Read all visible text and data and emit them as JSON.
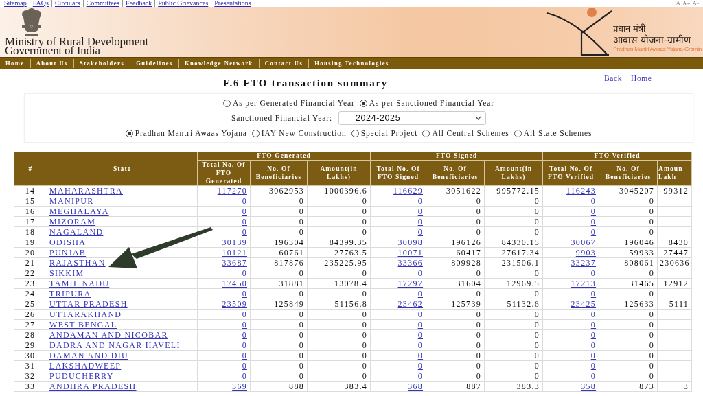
{
  "top_links": [
    "Sitemap",
    "FAQs",
    "Circulars",
    "Committees",
    "Feedback",
    "Public Grievances",
    "Presentations"
  ],
  "font_size_controls": [
    "A",
    "A+",
    "A-"
  ],
  "header": {
    "ministry": [
      "Ministry of Rural Development",
      "Government of India"
    ],
    "logo": {
      "hindi_line_1": "प्रधान मंत्री",
      "hindi_line_2": "आवास योजना-ग्रामीण",
      "english": "Pradhan Mantri Awaas Yojana-Gramin"
    }
  },
  "nav": [
    "Home",
    "About Us",
    "Stakeholders",
    "Guidelines",
    "Knowledge Network",
    "Contact Us",
    "Housing Technologies"
  ],
  "page": {
    "title": "F.6 FTO transaction summary",
    "links": [
      "Back",
      "Home"
    ]
  },
  "filters": {
    "year_basis": [
      {
        "label": "As per Generated Financial Year",
        "selected": false
      },
      {
        "label": "As per Sanctioned Financial Year",
        "selected": true
      }
    ],
    "year_field": {
      "label": "Sanctioned Financial Year:",
      "value": "2024-2025"
    },
    "schemes": [
      {
        "label": "Pradhan Mantri Awaas Yojana",
        "selected": true
      },
      {
        "label": "IAY New Construction",
        "selected": false
      },
      {
        "label": "Special Project",
        "selected": false
      },
      {
        "label": "All Central Schemes",
        "selected": false
      },
      {
        "label": "All State Schemes",
        "selected": false
      }
    ]
  },
  "table": {
    "groups": [
      "FTO Generated",
      "FTO Signed",
      "FTO Verified"
    ],
    "columns": [
      "#",
      "State",
      "Total No. Of FTO Generated",
      "No. Of Beneficiaries",
      "Amount(in Lakhs)",
      "Total No. Of FTO Signed",
      "No. Of Beneficiaries",
      "Amount(in Lakhs)",
      "Total No. Of FTO Verified",
      "No. Of Beneficiaries",
      "Amoun Lakh"
    ],
    "rows": [
      [
        "14",
        "MAHARASHTRA",
        "117270",
        "3062953",
        "1000396.6",
        "116629",
        "3051622",
        "995772.15",
        "116243",
        "3045207",
        "99312"
      ],
      [
        "15",
        "MANIPUR",
        "0",
        "0",
        "0",
        "0",
        "0",
        "0",
        "0",
        "0"
      ],
      [
        "16",
        "MEGHALAYA",
        "0",
        "0",
        "0",
        "0",
        "0",
        "0",
        "0",
        "0"
      ],
      [
        "17",
        "MIZORAM",
        "0",
        "0",
        "0",
        "0",
        "0",
        "0",
        "0",
        "0"
      ],
      [
        "18",
        "NAGALAND",
        "0",
        "0",
        "0",
        "0",
        "0",
        "0",
        "0",
        "0"
      ],
      [
        "19",
        "ODISHA",
        "30139",
        "196304",
        "84399.35",
        "30098",
        "196126",
        "84330.15",
        "30067",
        "196046",
        "8430"
      ],
      [
        "20",
        "PUNJAB",
        "10121",
        "60761",
        "27763.5",
        "10071",
        "60417",
        "27617.34",
        "9903",
        "59933",
        "27447"
      ],
      [
        "21",
        "RAJASTHAN",
        "33687",
        "817876",
        "235225.95",
        "33366",
        "809928",
        "231506.1",
        "33237",
        "808061",
        "230636"
      ],
      [
        "22",
        "SIKKIM",
        "0",
        "0",
        "0",
        "0",
        "0",
        "0",
        "0",
        "0"
      ],
      [
        "23",
        "TAMIL NADU",
        "17450",
        "31881",
        "13078.4",
        "17297",
        "31604",
        "12969.5",
        "17213",
        "31465",
        "12912"
      ],
      [
        "24",
        "TRIPURA",
        "0",
        "0",
        "0",
        "0",
        "0",
        "0",
        "0",
        "0"
      ],
      [
        "25",
        "UTTAR PRADESH",
        "23509",
        "125849",
        "51156.8",
        "23462",
        "125739",
        "51132.6",
        "23425",
        "125633",
        "5111"
      ],
      [
        "26",
        "UTTARAKHAND",
        "0",
        "0",
        "0",
        "0",
        "0",
        "0",
        "0",
        "0"
      ],
      [
        "27",
        "WEST BENGAL",
        "0",
        "0",
        "0",
        "0",
        "0",
        "0",
        "0",
        "0"
      ],
      [
        "28",
        "ANDAMAN AND NICOBAR",
        "0",
        "0",
        "0",
        "0",
        "0",
        "0",
        "0",
        "0"
      ],
      [
        "29",
        "DADRA AND NAGAR HAVELI",
        "0",
        "0",
        "0",
        "0",
        "0",
        "0",
        "0",
        "0"
      ],
      [
        "30",
        "DAMAN AND DIU",
        "0",
        "0",
        "0",
        "0",
        "0",
        "0",
        "0",
        "0"
      ],
      [
        "31",
        "LAKSHADWEEP",
        "0",
        "0",
        "0",
        "0",
        "0",
        "0",
        "0",
        "0"
      ],
      [
        "32",
        "PUDUCHERRY",
        "0",
        "0",
        "0",
        "0",
        "0",
        "0",
        "0",
        "0"
      ],
      [
        "33",
        "ANDHRA PRADESH",
        "369",
        "888",
        "383.4",
        "368",
        "887",
        "383.3",
        "358",
        "873",
        "3"
      ]
    ]
  }
}
